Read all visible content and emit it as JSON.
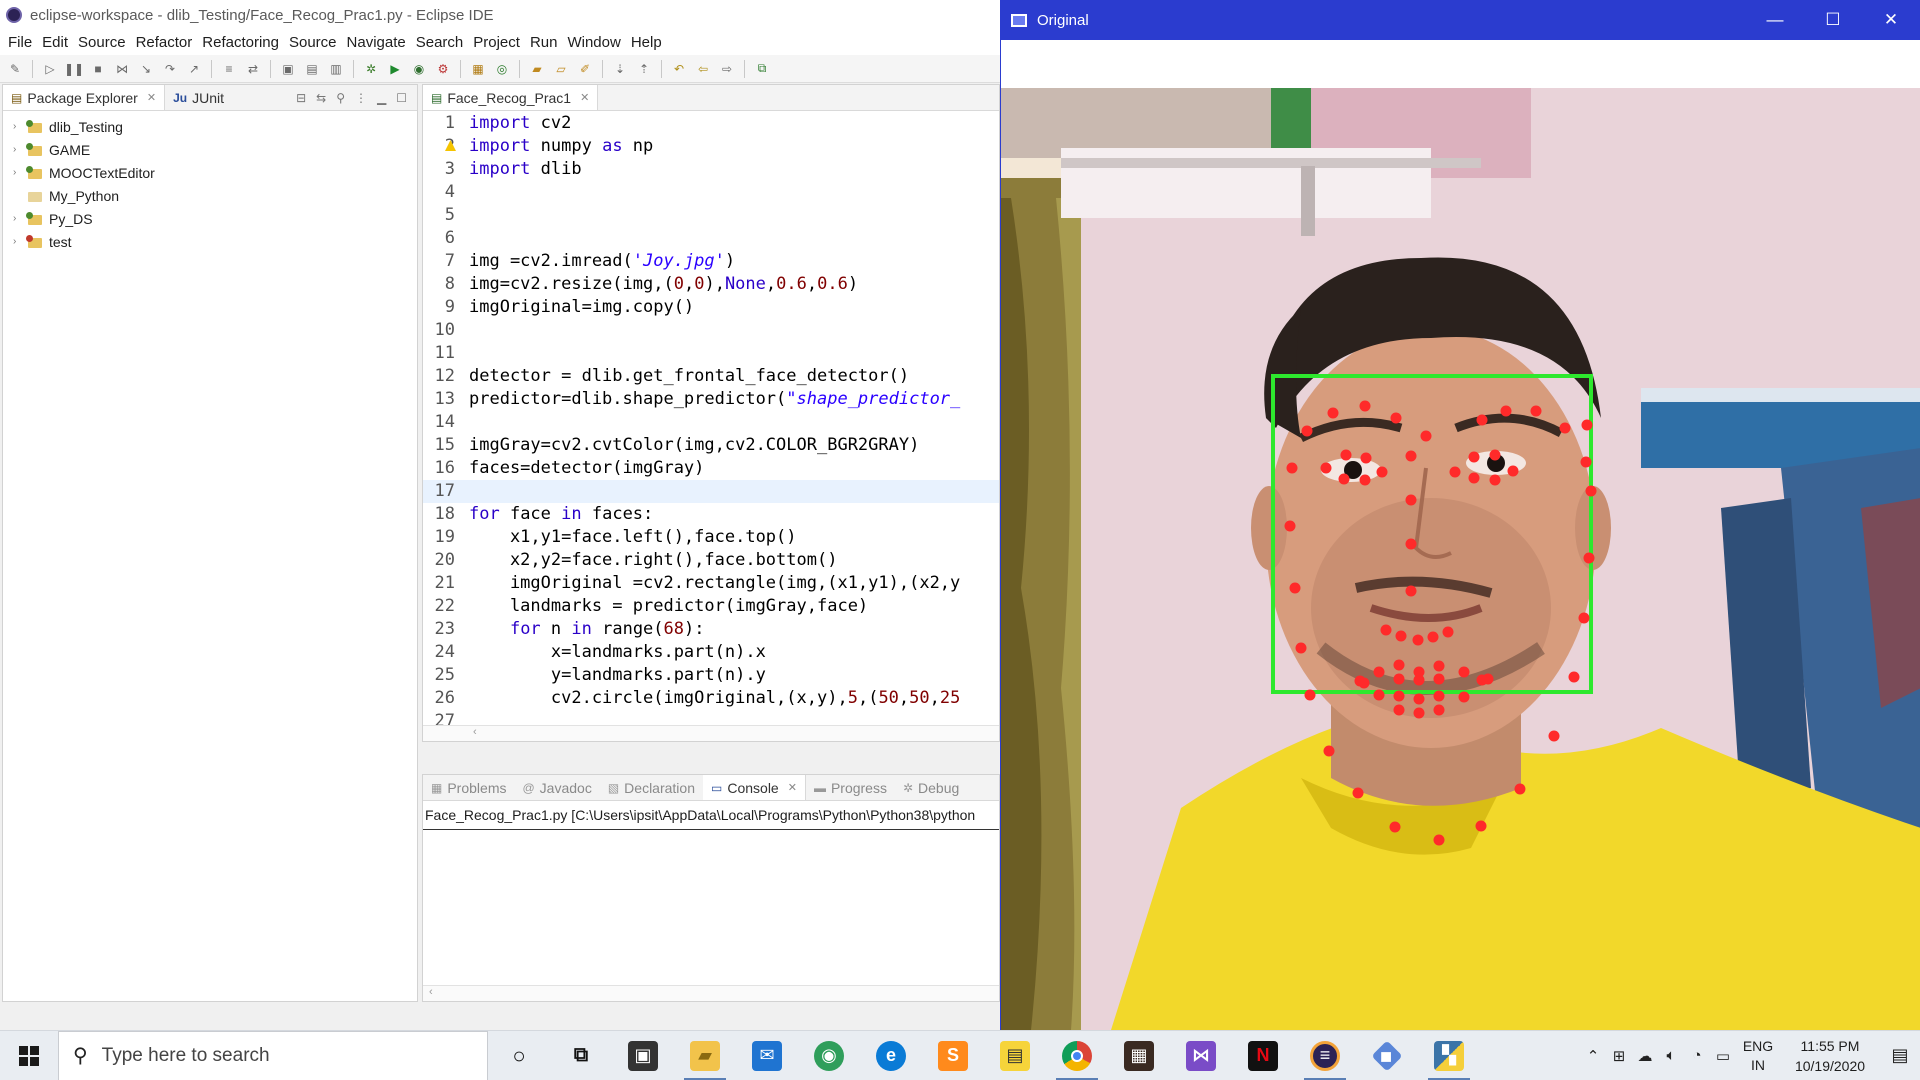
{
  "eclipse": {
    "title": "eclipse-workspace - dlib_Testing/Face_Recog_Prac1.py - Eclipse IDE",
    "menu": [
      "File",
      "Edit",
      "Source",
      "Refactor",
      "Refactoring",
      "Source",
      "Navigate",
      "Search",
      "Project",
      "Run",
      "Window",
      "Help"
    ],
    "package_explorer": {
      "tabs": [
        "Package Explorer",
        "JUnit"
      ],
      "projects": [
        "dlib_Testing",
        "GAME",
        "MOOCTextEditor",
        "My_Python",
        "Py_DS",
        "test"
      ]
    },
    "editor": {
      "tab": "Face_Recog_Prac1",
      "line_numbers": [
        "1",
        "2",
        "3",
        "4",
        "5",
        "6",
        "7",
        "8",
        "9",
        "10",
        "11",
        "12",
        "13",
        "14",
        "15",
        "16",
        "17",
        "18",
        "19",
        "20",
        "21",
        "22",
        "23",
        "24",
        "25",
        "26",
        "27"
      ],
      "lines": [
        "import cv2",
        "import numpy as np",
        "import dlib",
        "",
        "",
        "",
        "img =cv2.imread('Joy.jpg')",
        "img=cv2.resize(img,(0,0),None,0.6,0.6)",
        "imgOriginal=img.copy()",
        "",
        "",
        "detector = dlib.get_frontal_face_detector()",
        "predictor=dlib.shape_predictor(\"shape_predictor_",
        "",
        "imgGray=cv2.cvtColor(img,cv2.COLOR_BGR2GRAY)",
        "faces=detector(imgGray)",
        "",
        "for face in faces:",
        "    x1,y1=face.left(),face.top()",
        "    x2,y2=face.right(),face.bottom()",
        "    imgOriginal =cv2.rectangle(img,(x1,y1),(x2,y",
        "    landmarks = predictor(imgGray,face)",
        "    for n in range(68):",
        "        x=landmarks.part(n).x",
        "        y=landmarks.part(n).y",
        "        cv2.circle(imgOriginal,(x,y),5,(50,50,25",
        ""
      ]
    },
    "bottom_panel": {
      "tabs": [
        "Problems",
        "Javadoc",
        "Declaration",
        "Console",
        "Progress",
        "Debug"
      ],
      "active_tab": "Console",
      "console_line": "Face_Recog_Prac1.py [C:\\Users\\ipsit\\AppData\\Local\\Programs\\Python\\Python38\\python"
    }
  },
  "original_window": {
    "title": "Original",
    "minimize": "—",
    "maximize": "☐",
    "close": "✕"
  },
  "taskbar": {
    "search_placeholder": "Type here to search",
    "apps": [
      "cortana-icon",
      "task-view-icon",
      "store-icon",
      "file-explorer-icon",
      "mail-icon",
      "maps-icon",
      "edge-icon",
      "sublime-icon",
      "sticky-notes-icon",
      "chrome-icon",
      "photos-icon",
      "visual-studio-icon",
      "netflix-icon",
      "eclipse-icon",
      "git-icon",
      "python-icon"
    ],
    "lang_line1": "ENG",
    "lang_line2": "IN",
    "time": "11:55 PM",
    "date": "10/19/2020"
  },
  "colors": {
    "original_titlebar": "#2b3ccf",
    "face_box": "#2ee82e",
    "landmark": "#ff2a2a",
    "keyword": "#2a00c8",
    "string": "#2a00ff"
  }
}
